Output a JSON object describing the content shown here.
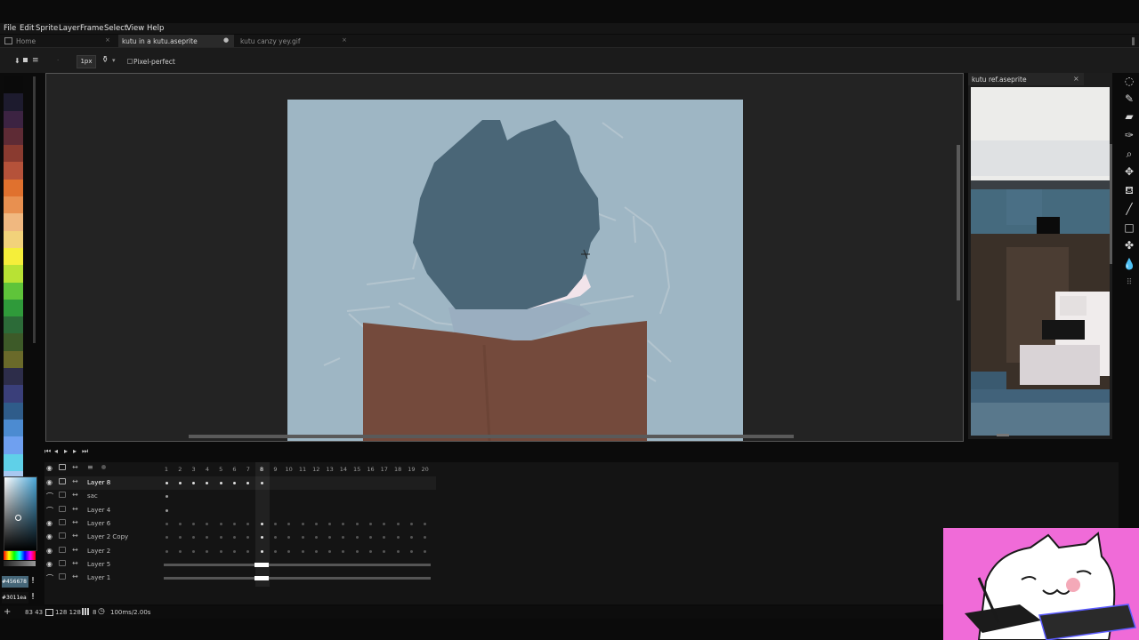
{
  "menu": [
    "File",
    "Edit",
    "Sprite",
    "Layer",
    "Frame",
    "Select",
    "View",
    "Help"
  ],
  "tabs": [
    {
      "label": "Home",
      "active": false
    },
    {
      "label": "kutu in a kutu.aseprite",
      "active": true
    },
    {
      "label": "kutu canzy yey.gif",
      "active": false
    }
  ],
  "toolbar": {
    "brush_size": "1px",
    "pixel_perfect_label": "Pixel-perfect"
  },
  "palette": [
    "#0a0a0a",
    "#1d1b2e",
    "#3c2342",
    "#5e2b35",
    "#8a3b30",
    "#b5523a",
    "#e0712e",
    "#e89050",
    "#f0b880",
    "#f2d27a",
    "#f5ee3a",
    "#b8e234",
    "#5fc43a",
    "#2f9a3a",
    "#2c6b38",
    "#3d5a28",
    "#6a6a2a",
    "#2d2d4a",
    "#3a3f7a",
    "#2f5c8a",
    "#4c8bd1",
    "#6fa0f0",
    "#5fd0e8",
    "#a8c8f0",
    "#ffffff",
    "#b0b8c0"
  ],
  "colors": {
    "fg_hex": "#456678",
    "bg_hex": "#3011ea",
    "accent": "#456678",
    "skin": "#7a4b3a"
  },
  "reference": {
    "title": "kutu ref.aseprite"
  },
  "timeline": {
    "frames": [
      "1",
      "2",
      "3",
      "4",
      "5",
      "6",
      "7",
      "8",
      "9",
      "10",
      "11",
      "12",
      "13",
      "14",
      "15",
      "16",
      "17",
      "18",
      "19",
      "20"
    ],
    "current_frame": 8,
    "layers": [
      {
        "name": "Layer 8",
        "visible": true,
        "locked": true
      },
      {
        "name": "sac",
        "visible": false,
        "locked": false
      },
      {
        "name": "Layer 4",
        "visible": false,
        "locked": false
      },
      {
        "name": "Layer 6",
        "visible": true,
        "locked": false
      },
      {
        "name": "Layer 2 Copy",
        "visible": true,
        "locked": false
      },
      {
        "name": "Layer 2",
        "visible": true,
        "locked": false
      },
      {
        "name": "Layer 5",
        "visible": true,
        "locked": false
      },
      {
        "name": "Layer 1",
        "visible": false,
        "locked": false
      }
    ]
  },
  "status": {
    "coords": "83 43",
    "size": "128 128",
    "frame": "8",
    "duration": "100ms/2.00s"
  }
}
